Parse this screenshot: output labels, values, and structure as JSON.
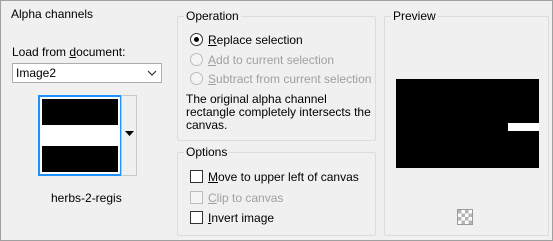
{
  "alpha_channels": {
    "title": "Alpha channels",
    "load_label_pre": "Load from ",
    "load_label_u": "d",
    "load_label_post": "ocument:",
    "document_value": "Image2",
    "channel_name": "herbs-2-regis"
  },
  "operation": {
    "title": "Operation",
    "options": [
      {
        "u": "R",
        "rest": "eplace selection",
        "selected": true,
        "enabled": true
      },
      {
        "u": "A",
        "rest": "dd to current selection",
        "selected": false,
        "enabled": false
      },
      {
        "u": "S",
        "rest": "ubtract from current selection",
        "selected": false,
        "enabled": false
      }
    ],
    "description_line1": "The original alpha channel",
    "description_line2": "rectangle completely intersects the",
    "description_line3": "canvas."
  },
  "options": {
    "title": "Options",
    "move": {
      "u": "M",
      "rest": "ove to upper left of canvas",
      "checked": false,
      "enabled": true
    },
    "clip": {
      "u": "C",
      "rest": "lip to canvas",
      "checked": false,
      "enabled": false
    },
    "invert": {
      "u": "I",
      "rest": "nvert image",
      "checked": false,
      "enabled": true
    }
  },
  "preview": {
    "title": "Preview",
    "transparency_icon": "checkerboard-icon"
  }
}
